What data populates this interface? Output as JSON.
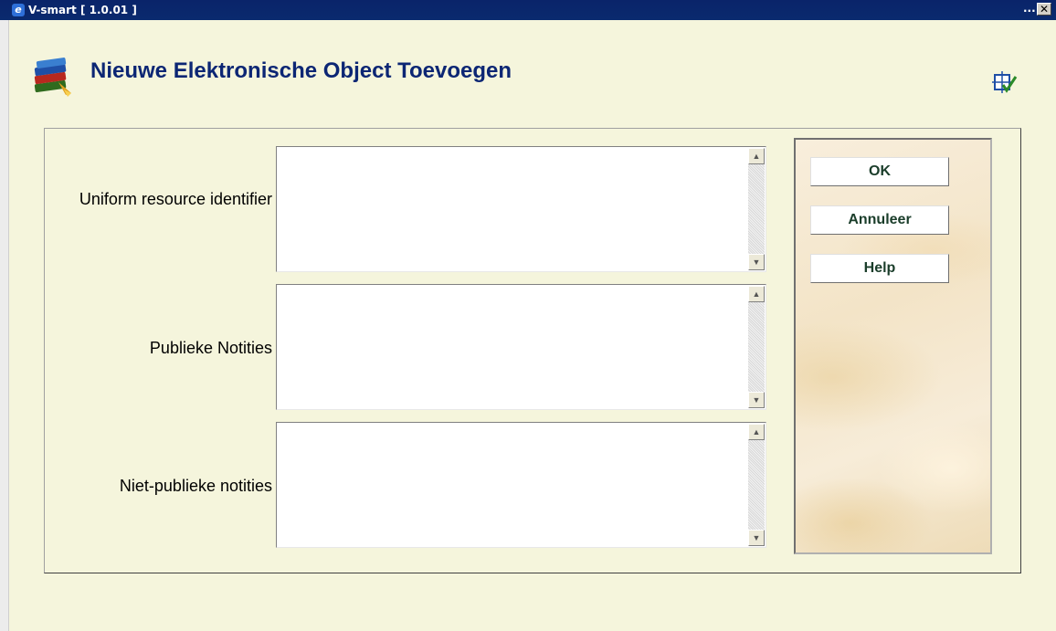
{
  "window": {
    "title": "V-smart [ 1.0.01 ]",
    "more_label": "...",
    "close_label": "✕"
  },
  "page": {
    "title": "Nieuwe Elektronische Object Toevoegen"
  },
  "fields": [
    {
      "label": "Uniform resource identifier",
      "value": ""
    },
    {
      "label": "Publieke Notities",
      "value": ""
    },
    {
      "label": "Niet-publieke notities",
      "value": ""
    }
  ],
  "buttons": {
    "ok": "OK",
    "cancel": "Annuleer",
    "help": "Help"
  },
  "icons": {
    "app": "internet-explorer-icon",
    "header": "books-icon",
    "tool": "select-tool-icon",
    "scroll_up": "scroll-up-arrow-icon",
    "scroll_down": "scroll-down-arrow-icon"
  },
  "colors": {
    "background": "#f5f5dc",
    "title_text": "#0c2674",
    "titlebar": "#0a246a",
    "button_text": "#1a3d2a"
  }
}
